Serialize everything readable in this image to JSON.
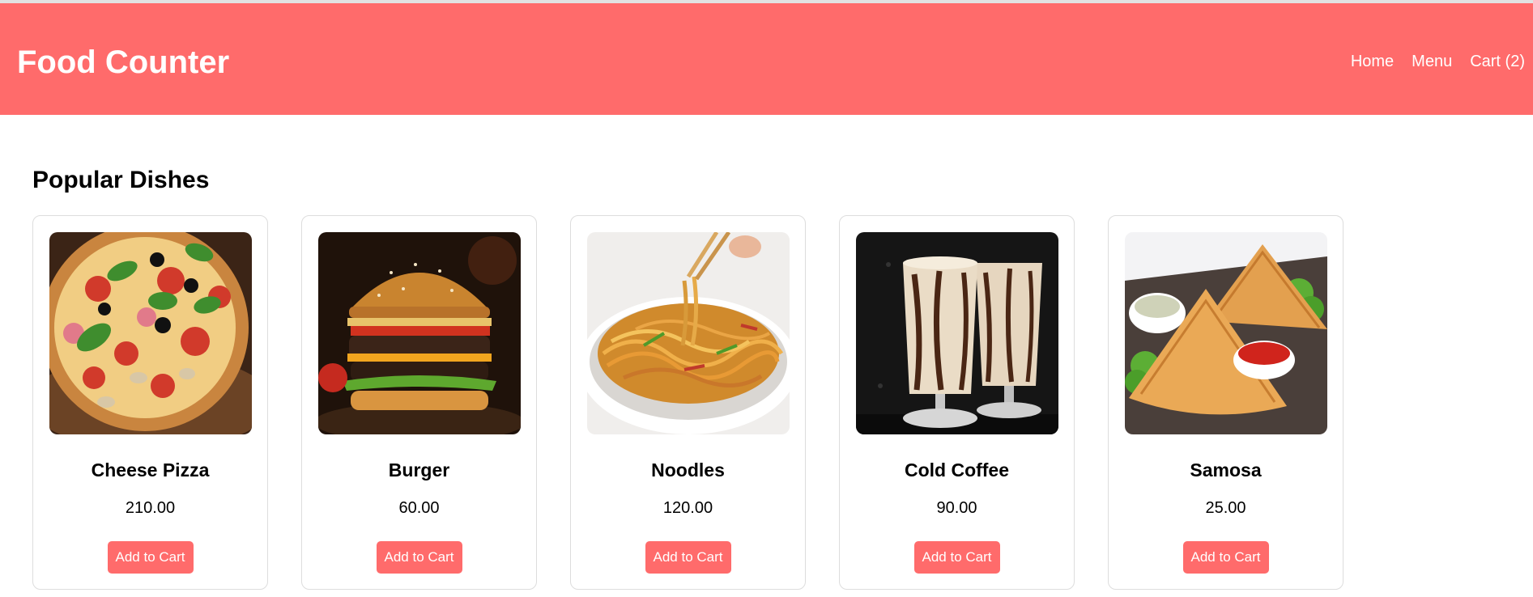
{
  "header": {
    "brand": "Food Counter",
    "nav": [
      {
        "label": "Home"
      },
      {
        "label": "Menu"
      },
      {
        "label": "Cart (2)"
      }
    ]
  },
  "main": {
    "section_title": "Popular Dishes",
    "dishes": [
      {
        "name": "Cheese Pizza",
        "price": "210.00",
        "button": "Add to Cart",
        "image": "pizza-photo"
      },
      {
        "name": "Burger",
        "price": "60.00",
        "button": "Add to Cart",
        "image": "burger-photo"
      },
      {
        "name": "Noodles",
        "price": "120.00",
        "button": "Add to Cart",
        "image": "noodles-photo"
      },
      {
        "name": "Cold Coffee",
        "price": "90.00",
        "button": "Add to Cart",
        "image": "cold-coffee-photo"
      },
      {
        "name": "Samosa",
        "price": "25.00",
        "button": "Add to Cart",
        "image": "samosa-photo"
      }
    ]
  },
  "colors": {
    "brand": "#ff6b6b",
    "text": "#000000",
    "card_border": "#dddddd"
  }
}
